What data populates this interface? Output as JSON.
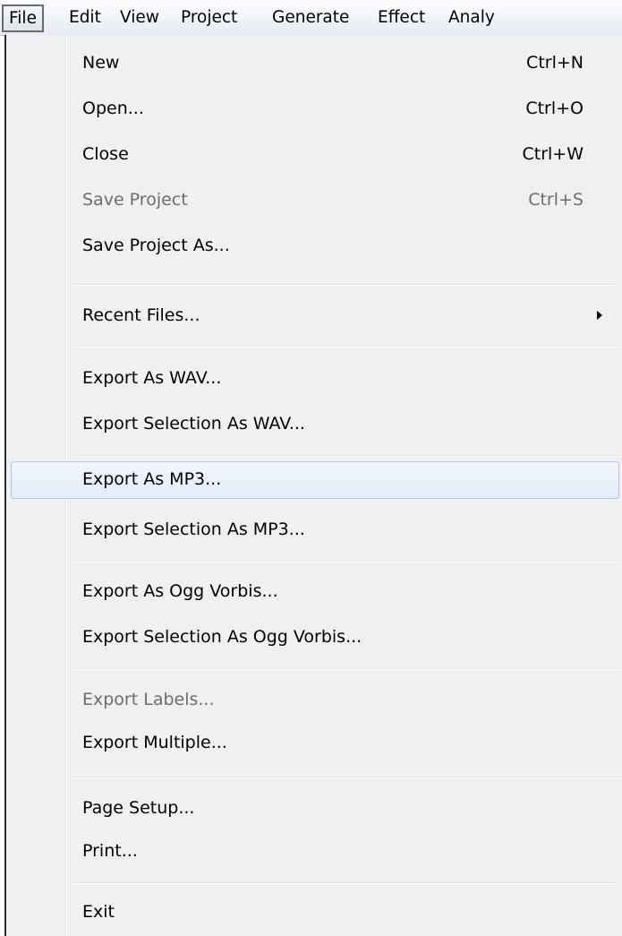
{
  "menubar": {
    "items": [
      {
        "label": "File"
      },
      {
        "label": "Edit"
      },
      {
        "label": "View"
      },
      {
        "label": "Project"
      },
      {
        "label": "Generate"
      },
      {
        "label": "Effect"
      },
      {
        "label": "Analy"
      }
    ]
  },
  "file_menu": {
    "items": [
      {
        "label": "New",
        "shortcut": "Ctrl+N"
      },
      {
        "label": "Open...",
        "shortcut": "Ctrl+O"
      },
      {
        "label": "Close",
        "shortcut": "Ctrl+W"
      },
      {
        "label": "Save Project",
        "shortcut": "Ctrl+S",
        "disabled": true
      },
      {
        "label": "Save Project As..."
      },
      {
        "label": "Recent Files...",
        "submenu": true
      },
      {
        "label": "Export As WAV..."
      },
      {
        "label": "Export Selection As WAV..."
      },
      {
        "label": "Export As MP3...",
        "highlighted": true
      },
      {
        "label": "Export Selection As MP3..."
      },
      {
        "label": "Export As Ogg Vorbis..."
      },
      {
        "label": "Export Selection As Ogg Vorbis..."
      },
      {
        "label": "Export Labels...",
        "disabled": true
      },
      {
        "label": "Export Multiple..."
      },
      {
        "label": "Page Setup..."
      },
      {
        "label": "Print..."
      },
      {
        "label": "Exit"
      }
    ]
  },
  "colors": {
    "highlight_border": "#a8c8ee",
    "disabled_text": "#6d6d6d",
    "menu_background": "#f0f0f0"
  }
}
